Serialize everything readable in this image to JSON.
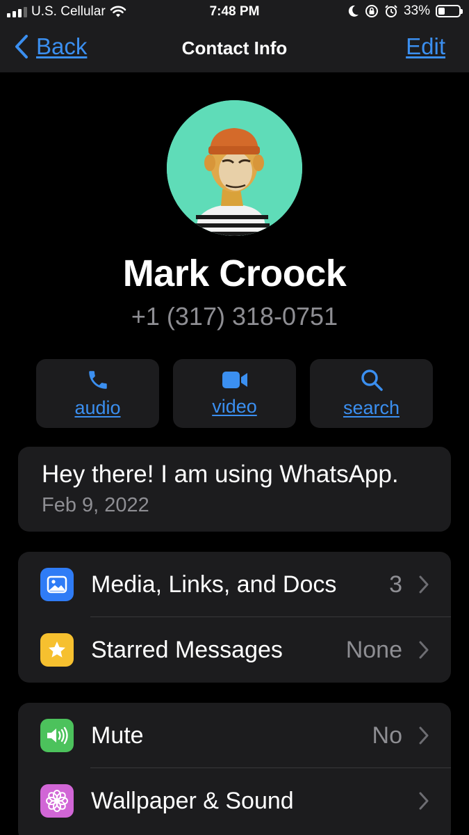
{
  "status_bar": {
    "carrier": "U.S. Cellular",
    "time": "7:48 PM",
    "battery": "33%",
    "battery_level": 0.33,
    "icons": [
      "signal-icon",
      "wifi-icon",
      "moon-icon",
      "orientation-lock-icon",
      "alarm-icon",
      "battery-icon"
    ]
  },
  "nav": {
    "back_label": "Back",
    "title": "Contact Info",
    "edit_label": "Edit"
  },
  "profile": {
    "name": "Mark Croock",
    "phone": "+1 (317) 318-0751",
    "avatar_bg": "#5fdcb8"
  },
  "actions": [
    {
      "label": "audio",
      "icon": "phone-icon"
    },
    {
      "label": "video",
      "icon": "video-camera-icon"
    },
    {
      "label": "search",
      "icon": "search-icon"
    }
  ],
  "about": {
    "text": "Hey there! I am using WhatsApp.",
    "date": "Feb 9, 2022"
  },
  "section_media": [
    {
      "label": "Media, Links, and Docs",
      "value": "3",
      "icon": "photo-icon",
      "icon_color": "#2f7cf6"
    },
    {
      "label": "Starred Messages",
      "value": "None",
      "icon": "star-icon",
      "icon_color": "#f6c02f"
    }
  ],
  "section_settings": [
    {
      "label": "Mute",
      "value": "No",
      "icon": "speaker-icon",
      "icon_color": "#4cc25c"
    },
    {
      "label": "Wallpaper & Sound",
      "value": "",
      "icon": "flower-icon",
      "icon_color": "#d166d6"
    }
  ],
  "colors": {
    "accent": "#3b8ff0",
    "background": "#000000",
    "card": "#1c1c1e",
    "secondary_text": "#8e8e93"
  }
}
